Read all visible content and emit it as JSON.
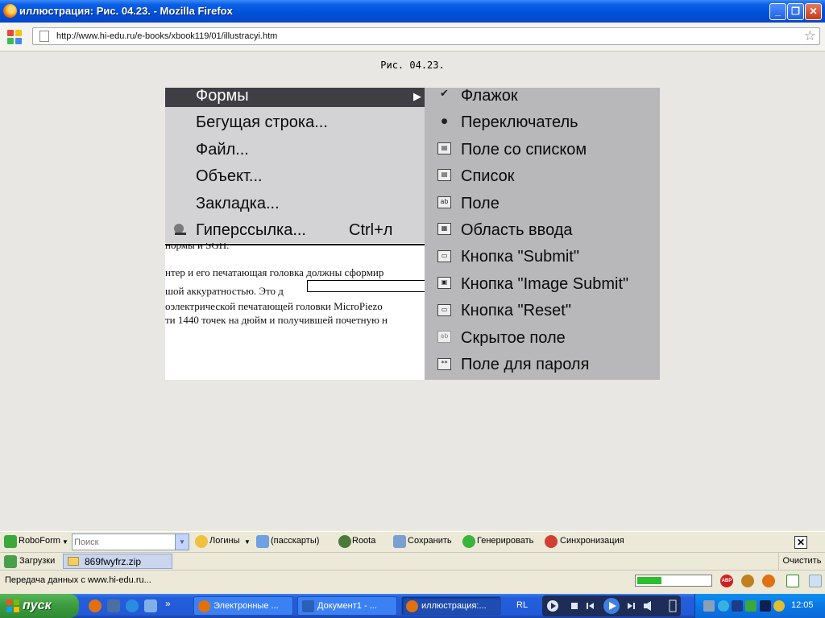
{
  "window": {
    "title": "иллюстрация: Рис. 04.23. - Mozilla Firefox",
    "min": "_",
    "max": "❐",
    "close": "✕"
  },
  "nav": {
    "url": "http://www.hi-edu.ru/e-books/xbook119/01/illustracyi.htm",
    "star": "☆"
  },
  "page": {
    "caption": "Рис. 04.23.",
    "menu_left": {
      "items": [
        "Формы",
        "Бегущая строка...",
        "Файл...",
        "Объект...",
        "Закладка...",
        "Гиперссылка..."
      ],
      "submenu_arrow": "▶",
      "hyperlink_shortcut": "Ctrl+л"
    },
    "doc_lines": [
      "нормы и SGH.",
      "нтер и его печатающая головка должны сформир",
      "шой аккуратностью. Это д",
      "оэлектрической печатающей головки MicroPiezo",
      "ти 1440 точек на дюйм и получившей почетную н"
    ],
    "menu_right": {
      "items": [
        "Флажок",
        "Переключатель",
        "Поле со списком",
        "Список",
        "Поле",
        "Область ввода",
        "Кнопка \"Submit\"",
        "Кнопка \"Image Submit\"",
        "Кнопка \"Reset\"",
        "Скрытое поле",
        "Поле для пароля"
      ],
      "icons": [
        "✔",
        "●",
        "▤",
        "▤",
        "ab",
        "▦",
        "▭",
        "▣",
        "▭",
        "ab",
        "**"
      ]
    }
  },
  "roboform": {
    "brand": "RoboForm",
    "search_placeholder": "Поиск",
    "logins": "Логины",
    "passcards": "(пасскарты)",
    "roota": "Roota",
    "save": "Сохранить",
    "generate": "Генерировать",
    "sync": "Синхронизация",
    "close": "✕"
  },
  "downloads": {
    "label": "Загрузки",
    "file": "869fwyfrz.zip",
    "clear": "Очистить"
  },
  "status": {
    "text": "Передача данных с www.hi-edu.ru...",
    "progress": 0.33,
    "abp": "ABP"
  },
  "taskbar": {
    "start": "пуск",
    "tasks": [
      "Электронные ...",
      "Документ1 - ...",
      "иллюстрация:..."
    ],
    "lang": "RL",
    "clock": "12:05",
    "more": "»"
  },
  "colors": {
    "titlebar": "#0a5fe8",
    "menu_highlight": "#3e3e44",
    "taskbar": "#245edb",
    "start": "#3c9a3e"
  }
}
